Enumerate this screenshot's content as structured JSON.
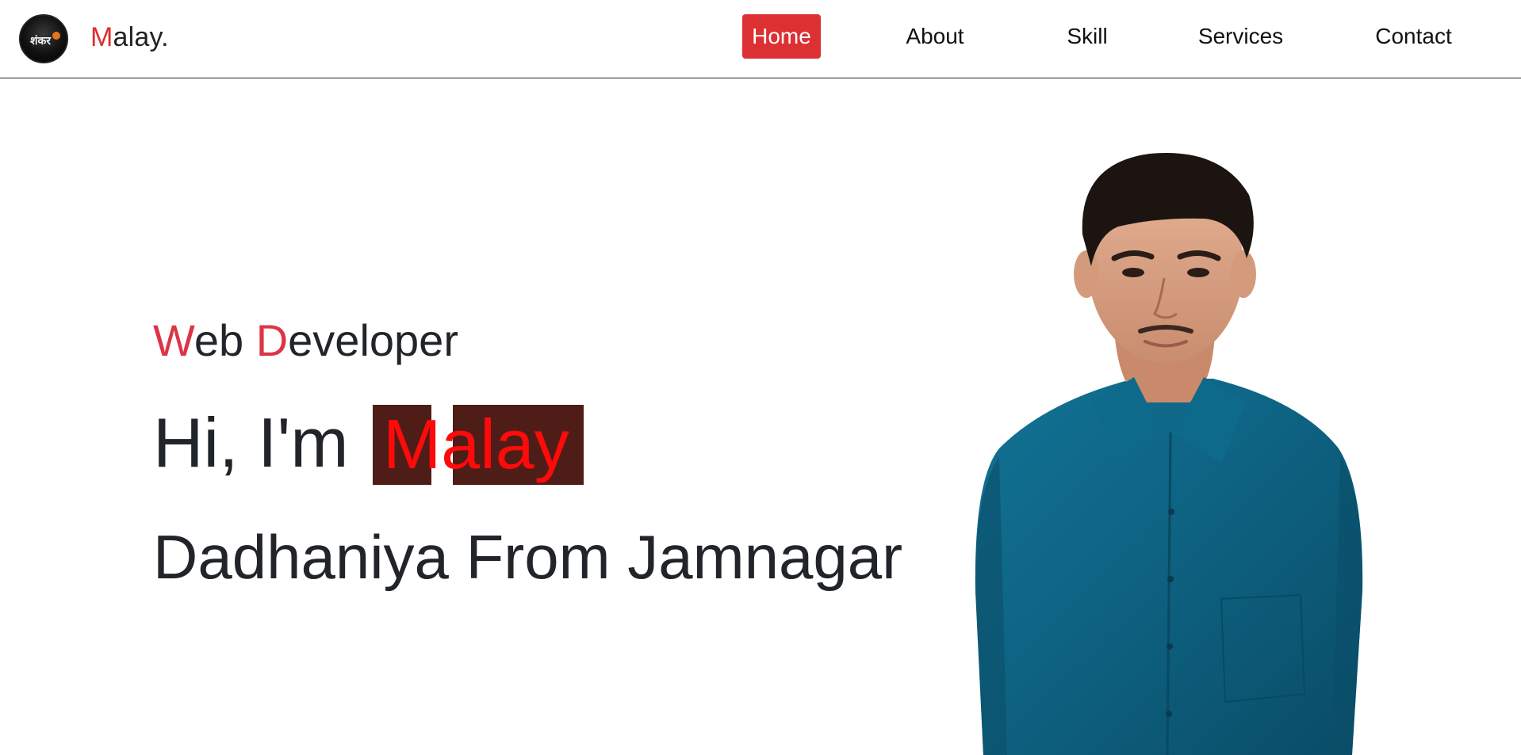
{
  "header": {
    "brand_first_letter": "M",
    "brand_rest": "alay."
  },
  "nav": {
    "home": "Home",
    "about": "About",
    "skill": "Skill",
    "services": "Services",
    "contact": "Contact"
  },
  "hero": {
    "subtitle_w": "W",
    "subtitle_eb": "eb ",
    "subtitle_d": "D",
    "subtitle_eveloper": "eveloper",
    "greeting": "Hi, I'm",
    "name": "Malay",
    "location": "Dadhaniya From Jamnagar"
  },
  "colors": {
    "accent": "#dc3545",
    "nav_active_bg": "#dc3032",
    "name_block_bg": "#4f1d17",
    "name_text": "#ff0a0a",
    "shirt": "#0f6382"
  },
  "icons": {
    "logo": "circular dark avatar logo",
    "portrait": "person-photo"
  }
}
